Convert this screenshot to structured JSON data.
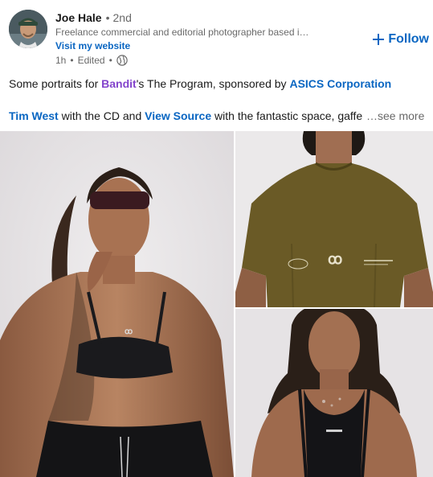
{
  "author": {
    "name": "Joe Hale",
    "degree": "2nd",
    "tagline": "Freelance commercial and editorial photographer based in…",
    "website_label": "Visit my website",
    "time": "1h",
    "edited": "Edited",
    "visibility_icon": "globe-icon"
  },
  "follow": {
    "label": "Follow",
    "icon": "plus-icon"
  },
  "post": {
    "line1": {
      "prefix": "Some portraits for ",
      "mention1": "Bandit",
      "middle": "'s The Program, sponsored by ",
      "mention2": "ASICS Corporation"
    },
    "line2": {
      "mention1": "Tim West",
      "middle1": " with the CD and ",
      "mention2": "View Source",
      "suffix": " with the fantastic space, gaffer and grip"
    },
    "see_more": "…see more"
  },
  "images": [
    {
      "name": "photo-woman-black-sports-bra"
    },
    {
      "name": "photo-man-olive-tshirt"
    },
    {
      "name": "photo-woman-black-tank"
    }
  ],
  "colors": {
    "link_blue": "#0a66c2",
    "mention_purple": "#8344cc",
    "muted": "#666666"
  }
}
